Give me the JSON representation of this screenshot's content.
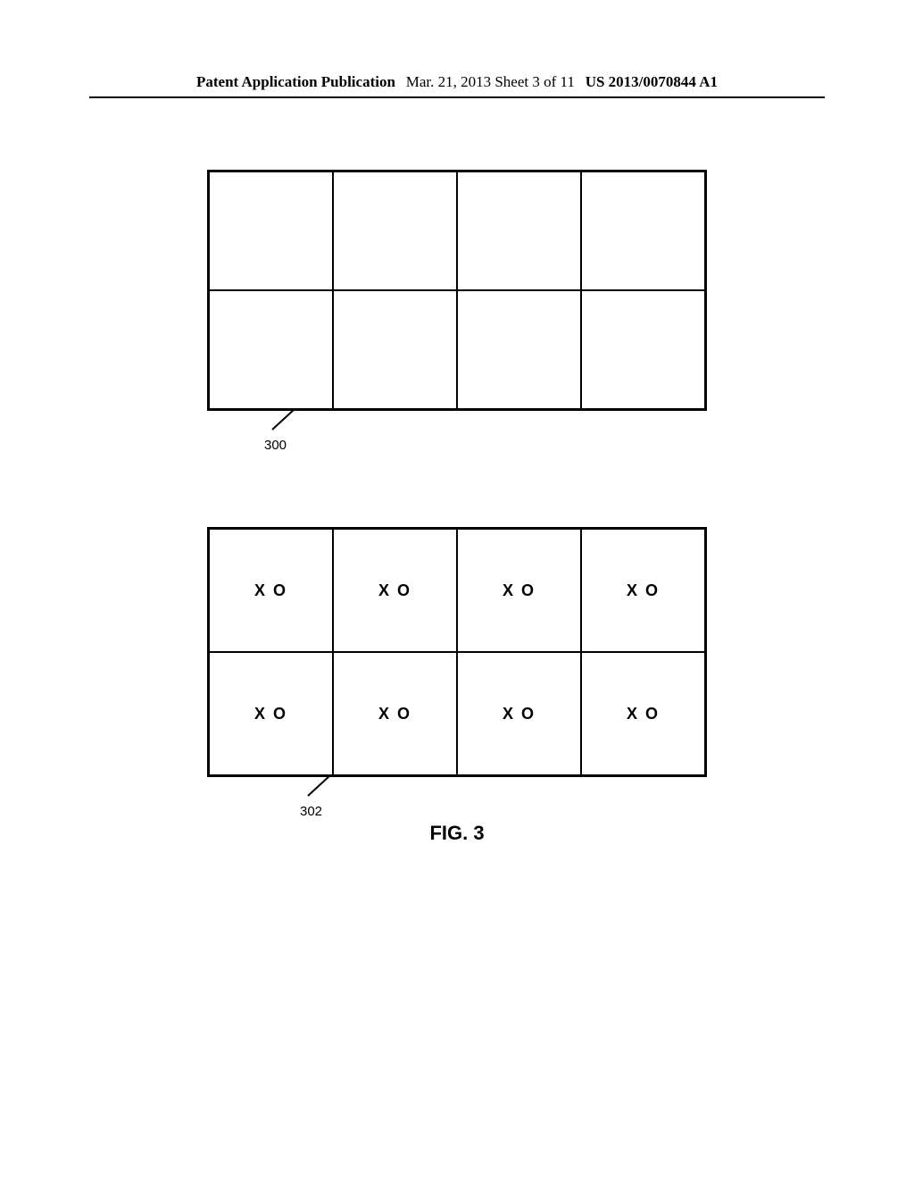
{
  "header": {
    "left": "Patent Application Publication",
    "center": "Mar. 21, 2013  Sheet 3 of 11",
    "right": "US 2013/0070844 A1"
  },
  "figure": {
    "ref_top": "300",
    "ref_bottom": "302",
    "cell_content": "X O",
    "caption": "FIG. 3"
  }
}
